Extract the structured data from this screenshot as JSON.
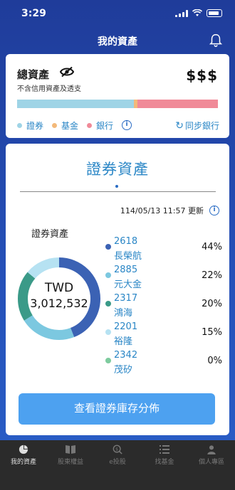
{
  "status_bar": {
    "time": "3:29"
  },
  "header": {
    "title": "我的資產"
  },
  "total": {
    "title": "總資產",
    "subtitle": "不含信用資產及透支",
    "value_masked": "$$$",
    "allocation": [
      {
        "label": "證券",
        "fraction": 0.58,
        "color": "#9fd4e6"
      },
      {
        "label": "基金",
        "fraction": 0.02,
        "color": "#f3b97a"
      },
      {
        "label": "銀行",
        "fraction": 0.4,
        "color": "#f08a98"
      }
    ],
    "sync_label": "同步銀行",
    "info_glyph": "i"
  },
  "securities": {
    "title": "證券資產",
    "updated": "114/05/13 11:57 更新",
    "donut_label": "證券資產",
    "currency": "TWD",
    "amount": "3,012,532",
    "holdings": [
      {
        "code": "2618",
        "name": "長榮航",
        "pct": "44%",
        "share": 44,
        "color": "#3b62b4"
      },
      {
        "code": "2885",
        "name": "元大金",
        "pct": "22%",
        "share": 22,
        "color": "#7cc8e0"
      },
      {
        "code": "2317",
        "name": "鴻海",
        "pct": "20%",
        "share": 20,
        "color": "#3a9a88"
      },
      {
        "code": "2201",
        "name": "裕隆",
        "pct": "15%",
        "share": 14,
        "color": "#b6e2f2"
      },
      {
        "code": "2342",
        "name": "茂矽",
        "pct": "0%",
        "share": 0,
        "color": "#7ecb9e"
      }
    ],
    "cta": "查看證券庫存分佈"
  },
  "tabs": [
    {
      "label": "我的資產",
      "icon": "pie-chart-icon",
      "active": true
    },
    {
      "label": "股東權益",
      "icon": "book-icon",
      "active": false
    },
    {
      "label": "e投股",
      "icon": "search-coin-icon",
      "active": false
    },
    {
      "label": "找基金",
      "icon": "list-icon",
      "active": false
    },
    {
      "label": "個人專區",
      "icon": "person-icon",
      "active": false
    }
  ]
}
